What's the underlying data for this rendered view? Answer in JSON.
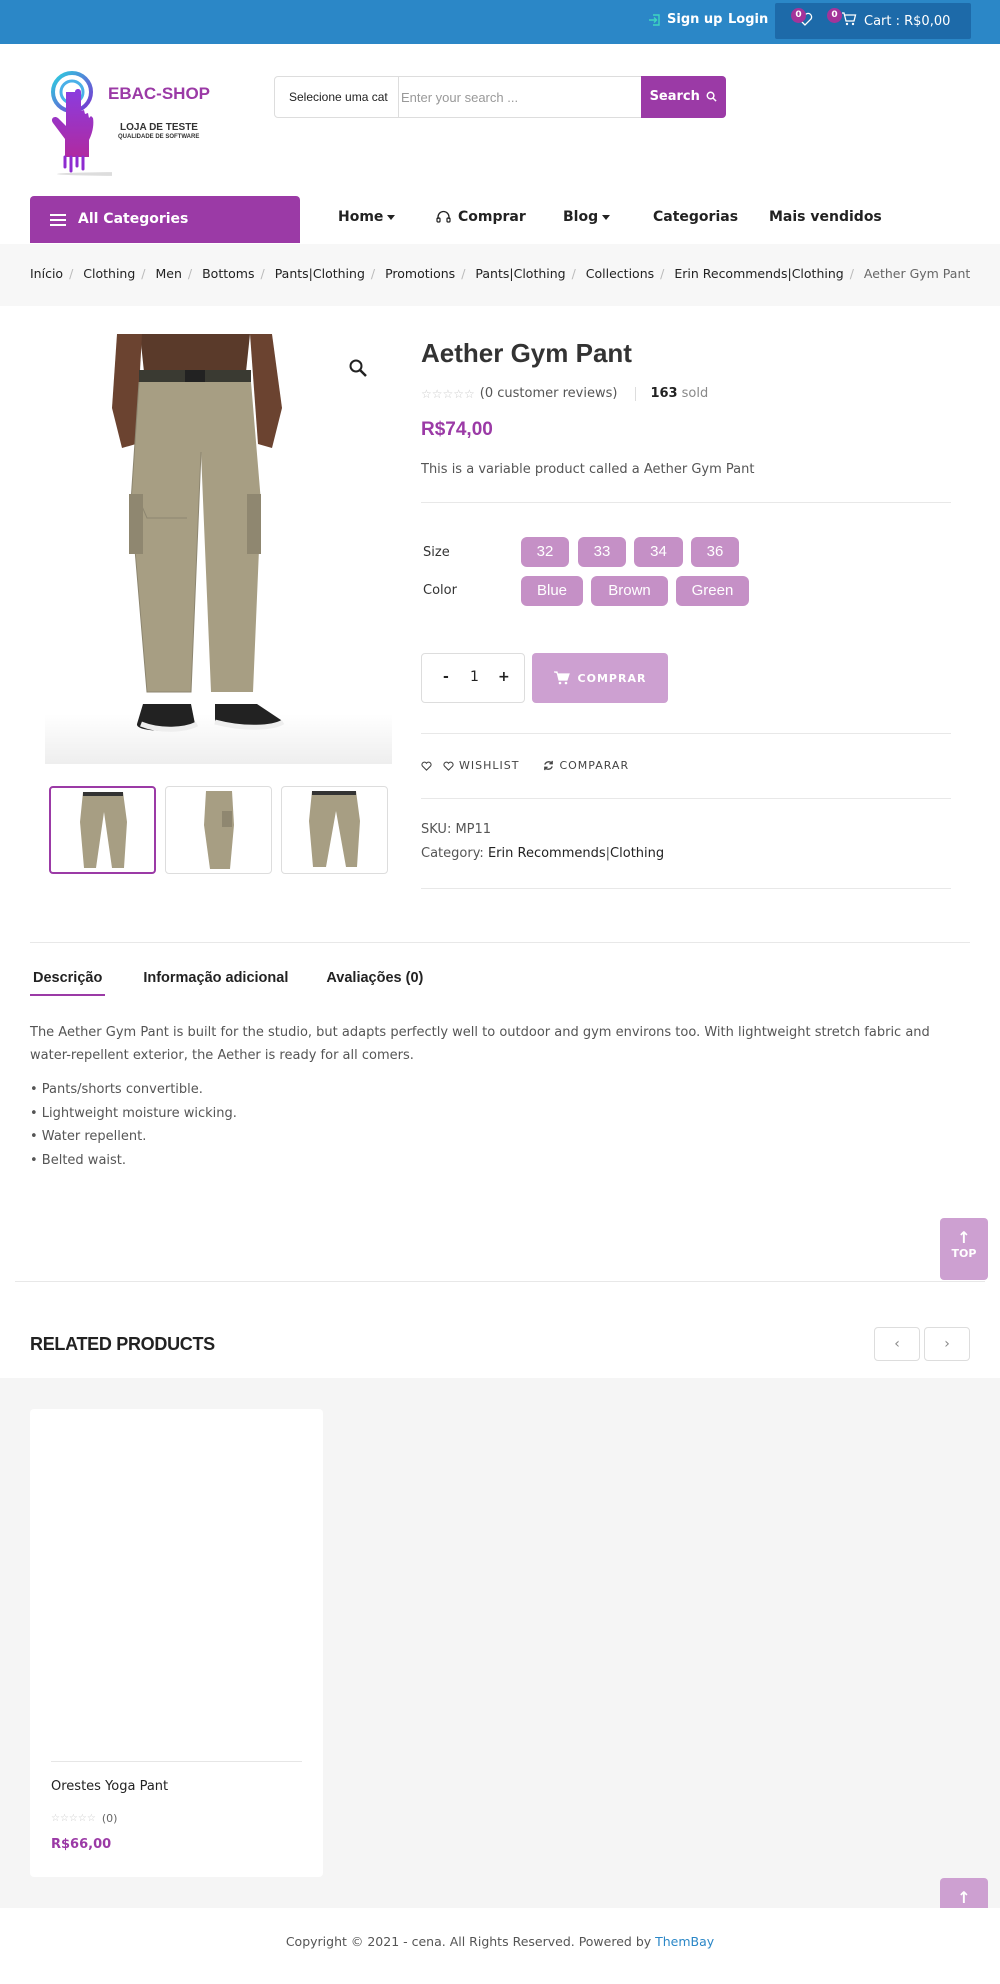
{
  "topbar": {
    "signup": "Sign up",
    "login": "Login",
    "wishlist_count": "0",
    "cart_count": "0",
    "cart_label": "Cart : R$0,00"
  },
  "header": {
    "logo_brand": "EBAC-SHOP",
    "logo_sub1": "LOJA DE TESTE",
    "logo_sub2": "QUALIDADE DE SOFTWARE",
    "category_select": "Selecione uma cat",
    "search_placeholder": "Enter your search ...",
    "search_button": "Search"
  },
  "nav": {
    "all_categories": "All Categories",
    "items": [
      "Home",
      "Comprar",
      "Blog",
      "Categorias",
      "Mais vendidos"
    ]
  },
  "breadcrumb": [
    "Início",
    "Clothing",
    "Men",
    "Bottoms",
    "Pants|Clothing",
    "Promotions",
    "Pants|Clothing",
    "Collections",
    "Erin Recommends|Clothing",
    "Aether Gym Pant"
  ],
  "product": {
    "title": "Aether Gym Pant",
    "reviews": "(0 customer reviews)",
    "sold_count": "163",
    "sold_label": "sold",
    "price": "R$74,00",
    "short_description": "This is a variable product called a Aether Gym Pant",
    "size_label": "Size",
    "sizes": [
      "32",
      "33",
      "34",
      "36"
    ],
    "color_label": "Color",
    "colors": [
      "Blue",
      "Brown",
      "Green"
    ],
    "qty_minus": "-",
    "qty_value": "1",
    "qty_plus": "+",
    "buy_button": "COMPRAR",
    "wishlist": "WISHLIST",
    "compare": "COMPARAR",
    "sku_label": "SKU:",
    "sku": "MP11",
    "category_label": "Category:",
    "category_a": "Erin Recommends",
    "category_b": "Clothing"
  },
  "tabs": [
    "Descrição",
    "Informação adicional",
    "Avaliações (0)"
  ],
  "description": {
    "text": "The Aether Gym Pant is built for the studio, but adapts perfectly well to outdoor and gym environs too. With lightweight stretch fabric and water-repellent exterior, the Aether is ready for all comers.",
    "bullets": [
      "• Pants/shorts convertible.",
      "• Lightweight moisture wicking.",
      "• Water repellent.",
      "• Belted waist."
    ]
  },
  "top_button": "TOP",
  "related": {
    "heading": "RELATED PRODUCTS",
    "items": [
      {
        "name": "Orestes Yoga Pant",
        "reviews": "(0)",
        "price": "R$66,00"
      }
    ]
  },
  "footer": {
    "copyright": "Copyright © 2021 - cena. All Rights Reserved. Powered by ",
    "powered_link": "ThemBay"
  },
  "colors": {
    "topbar": "#2b87c7",
    "accent": "#9b3aa6",
    "pill": "#c590c6",
    "button_light": "#cda0d1"
  }
}
